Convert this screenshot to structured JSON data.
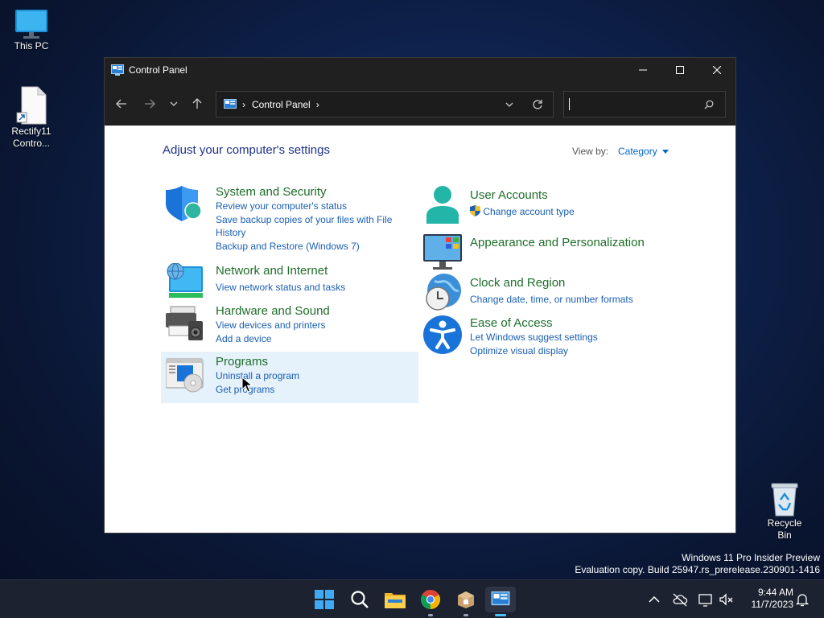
{
  "desktop": {
    "icons": [
      {
        "label": "This PC"
      },
      {
        "label": "Rectify11 Contro..."
      },
      {
        "label": "Recycle Bin"
      }
    ],
    "watermark_line1": "Windows 11 Pro Insider Preview",
    "watermark_line2": "Evaluation copy. Build 25947.rs_prerelease.230901-1416"
  },
  "window": {
    "title": "Control Panel",
    "address": {
      "root_sep": "›",
      "crumb": "Control Panel",
      "sep": "›"
    },
    "search": {
      "placeholder": ""
    }
  },
  "content": {
    "heading": "Adjust your computer's settings",
    "view_by_label": "View by:",
    "view_by_value": "Category",
    "categories_left": [
      {
        "title": "System and Security",
        "links": [
          "Review your computer's status",
          "Save backup copies of your files with File History",
          "Backup and Restore (Windows 7)"
        ]
      },
      {
        "title": "Network and Internet",
        "links": [
          "View network status and tasks"
        ]
      },
      {
        "title": "Hardware and Sound",
        "links": [
          "View devices and printers",
          "Add a device"
        ]
      },
      {
        "title": "Programs",
        "links": [
          "Uninstall a program",
          "Get programs"
        ]
      }
    ],
    "categories_right": [
      {
        "title": "User Accounts",
        "links": [
          "Change account type"
        ]
      },
      {
        "title": "Appearance and Personalization",
        "links": []
      },
      {
        "title": "Clock and Region",
        "links": [
          "Change date, time, or number formats"
        ]
      },
      {
        "title": "Ease of Access",
        "links": [
          "Let Windows suggest settings",
          "Optimize visual display"
        ]
      }
    ]
  },
  "taskbar": {
    "time": "9:44 AM",
    "date": "11/7/2023"
  },
  "colors": {
    "link": "#1a5fb4",
    "category_title": "#1e6e2a",
    "heading": "#1e3287",
    "hover_bg": "#e5f1fb"
  }
}
